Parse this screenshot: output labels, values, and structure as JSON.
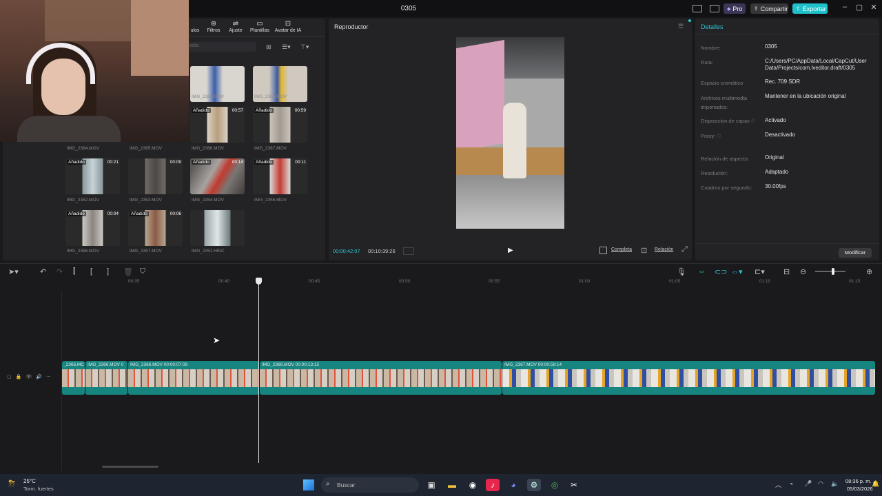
{
  "titlebar": {
    "project": "0305",
    "pro": "Pro",
    "share": "Compartir",
    "export": "Exportar"
  },
  "media_tabs": [
    "ulos",
    "Filtros",
    "Ajuste",
    "Plantillas",
    "Avatar de IA"
  ],
  "media_search_placeholder": "edia",
  "media_items": [
    {
      "name": "IMG_2362.MOV",
      "badge": "",
      "dur": ""
    },
    {
      "name": "IMG_2363.MOV",
      "badge": "",
      "dur": ""
    },
    {
      "name": "IMG_2366.MOV",
      "badge": "Añadido",
      "dur": "00:57"
    },
    {
      "name": "IMG_2367.MOV",
      "badge": "Añadido",
      "dur": "00:59"
    },
    {
      "name": "IMG_2364.MOV",
      "badge": "",
      "dur": ""
    },
    {
      "name": "IMG_2365.MOV",
      "badge": "",
      "dur": ""
    },
    {
      "name": "IMG_2352.MOV",
      "badge": "Añadido",
      "dur": "00:21"
    },
    {
      "name": "IMG_2353.MOV",
      "badge": "",
      "dur": "00:09"
    },
    {
      "name": "IMG_2354.MOV",
      "badge": "Añadido",
      "dur": "00:14"
    },
    {
      "name": "IMG_2355.MOV",
      "badge": "Añadido",
      "dur": "00:11"
    },
    {
      "name": "IMG_2356.MOV",
      "badge": "Añadido",
      "dur": "00:04"
    },
    {
      "name": "IMG_2357.MOV",
      "badge": "Añadido",
      "dur": "00:06"
    },
    {
      "name": "IMG_2351.HEIC",
      "badge": "",
      "dur": ""
    }
  ],
  "player": {
    "title": "Reproductor",
    "current_time": "00:00:42:07",
    "total_time": "00:10:39:26",
    "full_label": "Completa",
    "ratio_label": "Relación"
  },
  "details": {
    "title": "Detalles",
    "rows": [
      {
        "label": "Nombre:",
        "value": "0305"
      },
      {
        "label": "Ruta:",
        "value": "C:/Users/PC/AppData/Local/CapCut/User Data/Projects/com.lveditor.draft/0305"
      },
      {
        "label": "Espacio cromático",
        "value": "Rec. 709 SDR"
      },
      {
        "label": "Archivos multimedia importados:",
        "value": "Mantener en la ubicación original"
      },
      {
        "label": "Disposición de capas",
        "value": "Activado"
      },
      {
        "label": "Proxy:",
        "value": "Desactivado"
      },
      {
        "label": "Relación de aspecto:",
        "value": "Original"
      },
      {
        "label": "Resolución:",
        "value": "Adaptado"
      },
      {
        "label": "Cuadros por segundo:",
        "value": "30.00fps"
      }
    ],
    "modify": "Modificar"
  },
  "ruler": [
    "00:35",
    "00:40",
    "00:45",
    "00:50",
    "00:55",
    "01:00",
    "01:05",
    "01:10",
    "01:15"
  ],
  "clips": [
    {
      "label": "_2366.MC"
    },
    {
      "label": "IMG_2366.MOV  0"
    },
    {
      "label": "IMG_2366.MOV  00:00:07:08"
    },
    {
      "label": "IMG_2366.MOV  00:00:13:15"
    },
    {
      "label": "IMG_2367.MOV  00:00:58:14"
    }
  ],
  "taskbar": {
    "weather_temp": "25°C",
    "weather_desc": "Torm. fuertes",
    "search": "Buscar",
    "time": "08:36 p. m.",
    "date": "05/03/2026"
  }
}
